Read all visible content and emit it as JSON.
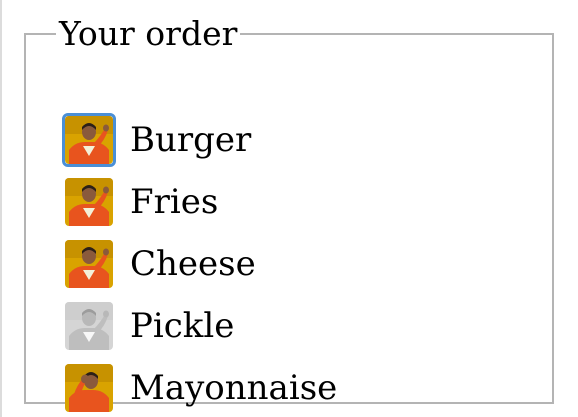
{
  "legend": "Your order",
  "accent_color": "#4a8fd6",
  "items": [
    {
      "label": "Burger",
      "checked": true,
      "focused": true,
      "icon": "meme-approve-icon"
    },
    {
      "label": "Fries",
      "checked": true,
      "focused": false,
      "icon": "meme-approve-icon"
    },
    {
      "label": "Cheese",
      "checked": true,
      "focused": false,
      "icon": "meme-approve-icon"
    },
    {
      "label": "Pickle",
      "checked": false,
      "focused": false,
      "icon": "meme-approve-icon"
    },
    {
      "label": "Mayonnaise",
      "checked": false,
      "focused": false,
      "icon": "meme-reject-icon"
    }
  ]
}
